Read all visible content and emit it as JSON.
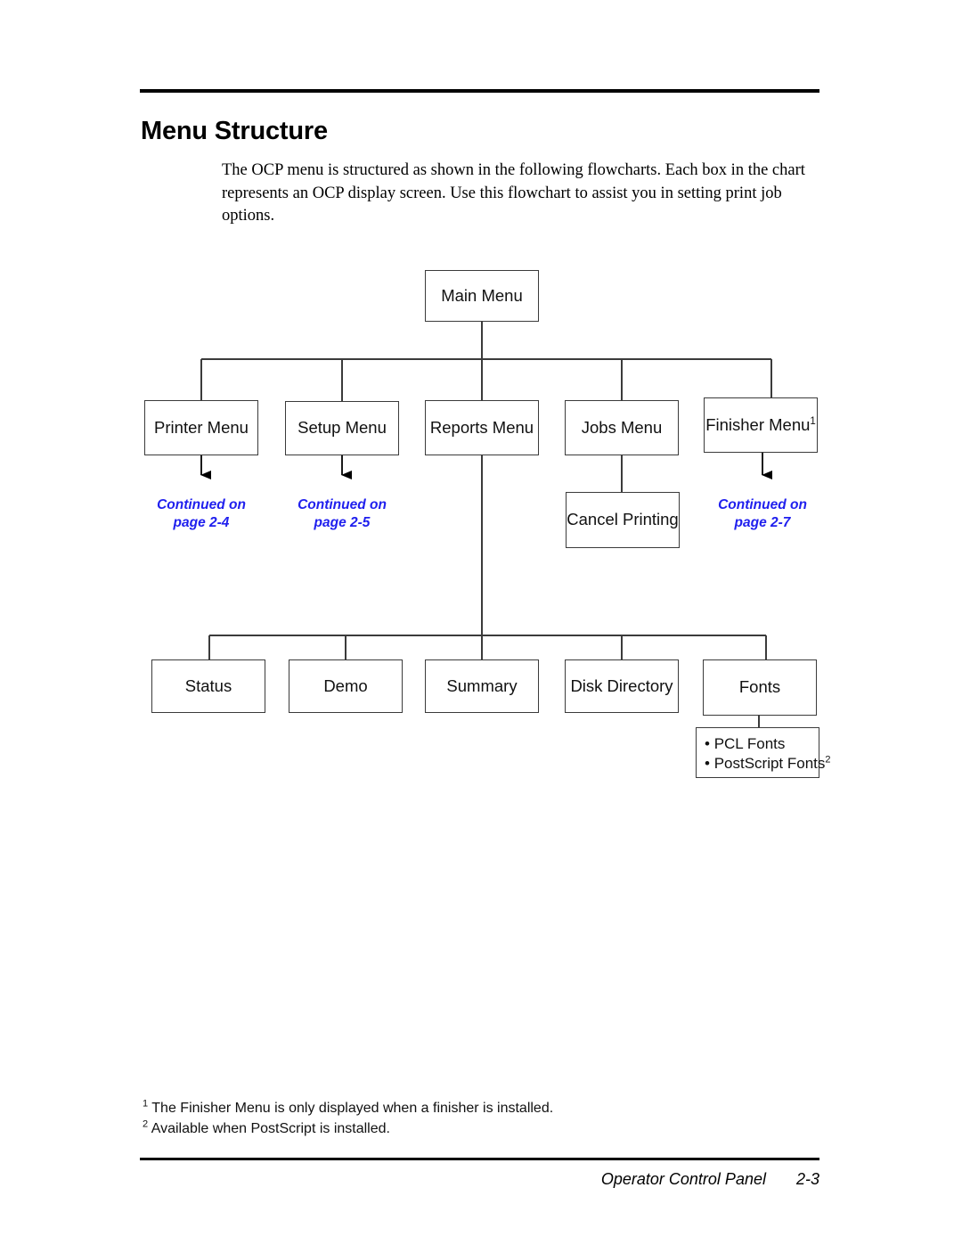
{
  "document": {
    "title": "Menu Structure",
    "intro": "The OCP menu is structured as shown in the following flowcharts. Each box in the chart represents an OCP display screen. Use this flowchart to assist you in setting print job options."
  },
  "chart_data": {
    "type": "diagram",
    "title": "OCP Menu Structure flowchart",
    "root": "Main Menu",
    "nodes": [
      {
        "id": "main",
        "label": "Main Menu",
        "level": 0
      },
      {
        "id": "printer",
        "label": "Printer Menu",
        "level": 1
      },
      {
        "id": "setup",
        "label": "Setup Menu",
        "level": 1
      },
      {
        "id": "reports",
        "label": "Reports Menu",
        "level": 1
      },
      {
        "id": "jobs",
        "label": "Jobs Menu",
        "level": 1
      },
      {
        "id": "finisher",
        "label": "Finisher Menu",
        "footnote": "1",
        "level": 1
      },
      {
        "id": "cancel",
        "label": "Cancel Printing",
        "level": 2
      },
      {
        "id": "status",
        "label": "Status",
        "level": 2
      },
      {
        "id": "demo",
        "label": "Demo",
        "level": 2
      },
      {
        "id": "summary",
        "label": "Summary",
        "level": 2
      },
      {
        "id": "diskdir",
        "label": "Disk Directory",
        "level": 2
      },
      {
        "id": "fonts",
        "label": "Fonts",
        "level": 2
      },
      {
        "id": "fontlist",
        "label": "PCL Fonts / PostScript Fonts",
        "level": 3
      }
    ],
    "font_list_items": [
      {
        "text": "PCL Fonts",
        "footnote": ""
      },
      {
        "text": "PostScript Fonts",
        "footnote": "2"
      }
    ],
    "edges": [
      {
        "from": "main",
        "to": "printer"
      },
      {
        "from": "main",
        "to": "setup"
      },
      {
        "from": "main",
        "to": "reports"
      },
      {
        "from": "main",
        "to": "jobs"
      },
      {
        "from": "main",
        "to": "finisher"
      },
      {
        "from": "jobs",
        "to": "cancel"
      },
      {
        "from": "reports",
        "to": "status"
      },
      {
        "from": "reports",
        "to": "demo"
      },
      {
        "from": "reports",
        "to": "summary"
      },
      {
        "from": "reports",
        "to": "diskdir"
      },
      {
        "from": "reports",
        "to": "fonts"
      },
      {
        "from": "fonts",
        "to": "fontlist"
      },
      {
        "from": "printer",
        "to": "continued-2-4",
        "arrow": true
      },
      {
        "from": "setup",
        "to": "continued-2-5",
        "arrow": true
      },
      {
        "from": "finisher",
        "to": "continued-2-7",
        "arrow": true
      }
    ],
    "continued_refs": [
      {
        "id": "continued-2-4",
        "line1": "Continued on",
        "line2": "page 2-4",
        "color": "#2020ee"
      },
      {
        "id": "continued-2-5",
        "line1": "Continued on",
        "line2": "page 2-5",
        "color": "#2020ee"
      },
      {
        "id": "continued-2-7",
        "line1": "Continued on",
        "line2": "page 2-7",
        "color": "#2020ee"
      }
    ]
  },
  "footnotes": [
    {
      "marker": "1",
      "text": "The Finisher Menu is only displayed when a finisher is installed."
    },
    {
      "marker": "2",
      "text": "Available when PostScript is installed."
    }
  ],
  "footer": {
    "section": "Operator Control Panel",
    "page": "2-3"
  }
}
